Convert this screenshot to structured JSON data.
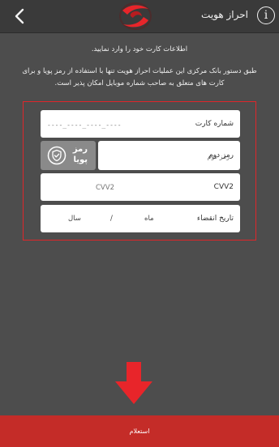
{
  "header": {
    "title": "احراز هویت",
    "info_symbol": "i",
    "back_icon": "chevron-left-icon",
    "logo_icon": "bank-logo-icon",
    "background": "#3a3a3a"
  },
  "intro_text": "اطلاعات کارت خود را وارد نمایید.",
  "description": "طبق دستور بانک مرکزی این عملیات احراز هویت تنها با استفاده از رمز پویا و برای کارت های متعلق به صاحب شماره موبایل امکان پذیر است.",
  "form": {
    "highlight_color": "#e0262a",
    "card_number": {
      "label": "شماره کارت",
      "placeholder": "----_----_----_----"
    },
    "password": {
      "label": "رمز دوم",
      "placeholder": "رمز دوم"
    },
    "otp_button": {
      "line1": "رمز",
      "line2": "پویا",
      "icon": "shield-check-icon"
    },
    "cvv2": {
      "label": "CVV2",
      "placeholder": "CVV2"
    },
    "expiry": {
      "label": "تاریخ انقضاء",
      "month": "ماه",
      "separator": "/",
      "year": "سال"
    }
  },
  "arrow_color": "#e8252a",
  "submit": {
    "label": "استعلام",
    "color": "#c42c28"
  }
}
